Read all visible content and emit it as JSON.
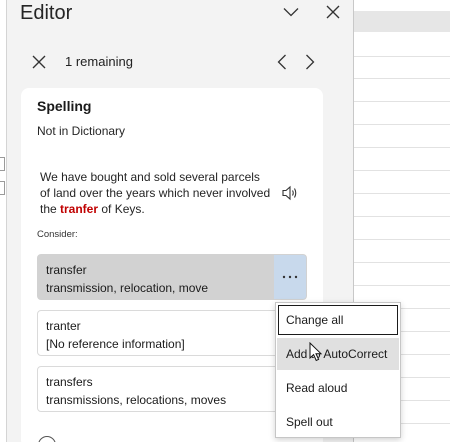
{
  "pane": {
    "title": "Editor",
    "remaining_text": "1 remaining"
  },
  "card": {
    "title": "Spelling",
    "subtitle": "Not in Dictionary",
    "context": {
      "before": "We have bought and sold several parcels of land over the years which never involved the ",
      "error_word": "tranfer",
      "after": " of Keys."
    },
    "consider_label": "Consider:",
    "suggestions": [
      {
        "word": "transfer",
        "synonyms": "transmission, relocation, move",
        "selected": true
      },
      {
        "word": "tranter",
        "synonyms": "[No reference information]",
        "selected": false
      },
      {
        "word": "transfers",
        "synonyms": "transmissions, relocations, moves",
        "selected": false
      }
    ]
  },
  "menu": {
    "items": [
      "Change all",
      "Add to AutoCorrect",
      "Read aloud",
      "Spell out"
    ],
    "focused_index": 0,
    "hover_index": 1
  },
  "icons": {
    "collapse": "chevron-down-icon",
    "close_pane": "close-icon",
    "ignore": "close-icon",
    "previous": "chevron-left-icon",
    "next": "chevron-right-icon",
    "read_aloud": "speaker-icon",
    "more_options": "ellipsis-icon",
    "pointer": "mouse-cursor-icon"
  },
  "colors": {
    "pane_background": "#f3f3f3",
    "card_background": "#ffffff",
    "error_word": "#c00000",
    "selected_suggestion": "#d2d2d2",
    "more_button": "#c8d9ec",
    "menu_hover": "#e0e0e0"
  }
}
